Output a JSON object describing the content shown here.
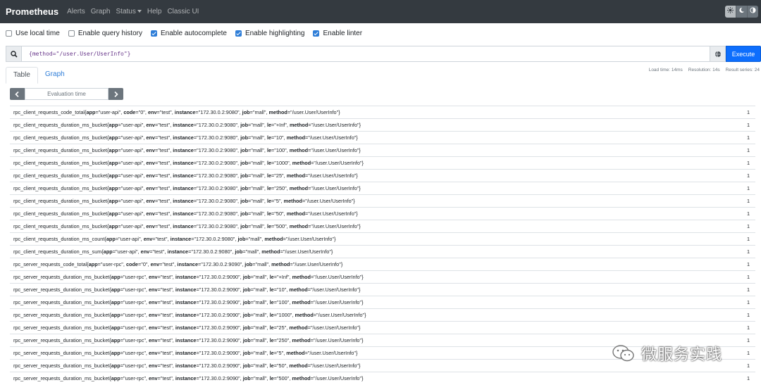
{
  "navbar": {
    "brand": "Prometheus",
    "links": [
      "Alerts",
      "Graph",
      "Status",
      "Help",
      "Classic UI"
    ]
  },
  "options": [
    {
      "label": "Use local time",
      "checked": false
    },
    {
      "label": "Enable query history",
      "checked": false
    },
    {
      "label": "Enable autocomplete",
      "checked": true
    },
    {
      "label": "Enable highlighting",
      "checked": true
    },
    {
      "label": "Enable linter",
      "checked": true
    }
  ],
  "query": {
    "value": "{method=\"/user.User/UserInfo\"}",
    "execute_label": "Execute"
  },
  "tabs": {
    "table": "Table",
    "graph": "Graph"
  },
  "stats": {
    "load_time": "Load time: 14ms",
    "resolution": "Resolution: 14s",
    "result_series": "Result series: 24"
  },
  "eval_time": {
    "placeholder": "Evaluation time"
  },
  "results": [
    {
      "metric": "rpc_client_requests_code_total",
      "labels": [
        [
          "app",
          "user-api"
        ],
        [
          "code",
          "0"
        ],
        [
          "env",
          "test"
        ],
        [
          "instance",
          "172.30.0.2:9080"
        ],
        [
          "job",
          "mall"
        ],
        [
          "method",
          "/user.User/UserInfo"
        ]
      ],
      "value": "1"
    },
    {
      "metric": "rpc_client_requests_duration_ms_bucket",
      "labels": [
        [
          "app",
          "user-api"
        ],
        [
          "env",
          "test"
        ],
        [
          "instance",
          "172.30.0.2:9080"
        ],
        [
          "job",
          "mall"
        ],
        [
          "le",
          "+Inf"
        ],
        [
          "method",
          "/user.User/UserInfo"
        ]
      ],
      "value": "1"
    },
    {
      "metric": "rpc_client_requests_duration_ms_bucket",
      "labels": [
        [
          "app",
          "user-api"
        ],
        [
          "env",
          "test"
        ],
        [
          "instance",
          "172.30.0.2:9080"
        ],
        [
          "job",
          "mall"
        ],
        [
          "le",
          "10"
        ],
        [
          "method",
          "/user.User/UserInfo"
        ]
      ],
      "value": "1"
    },
    {
      "metric": "rpc_client_requests_duration_ms_bucket",
      "labels": [
        [
          "app",
          "user-api"
        ],
        [
          "env",
          "test"
        ],
        [
          "instance",
          "172.30.0.2:9080"
        ],
        [
          "job",
          "mall"
        ],
        [
          "le",
          "100"
        ],
        [
          "method",
          "/user.User/UserInfo"
        ]
      ],
      "value": "1"
    },
    {
      "metric": "rpc_client_requests_duration_ms_bucket",
      "labels": [
        [
          "app",
          "user-api"
        ],
        [
          "env",
          "test"
        ],
        [
          "instance",
          "172.30.0.2:9080"
        ],
        [
          "job",
          "mall"
        ],
        [
          "le",
          "1000"
        ],
        [
          "method",
          "/user.User/UserInfo"
        ]
      ],
      "value": "1"
    },
    {
      "metric": "rpc_client_requests_duration_ms_bucket",
      "labels": [
        [
          "app",
          "user-api"
        ],
        [
          "env",
          "test"
        ],
        [
          "instance",
          "172.30.0.2:9080"
        ],
        [
          "job",
          "mall"
        ],
        [
          "le",
          "25"
        ],
        [
          "method",
          "/user.User/UserInfo"
        ]
      ],
      "value": "1"
    },
    {
      "metric": "rpc_client_requests_duration_ms_bucket",
      "labels": [
        [
          "app",
          "user-api"
        ],
        [
          "env",
          "test"
        ],
        [
          "instance",
          "172.30.0.2:9080"
        ],
        [
          "job",
          "mall"
        ],
        [
          "le",
          "250"
        ],
        [
          "method",
          "/user.User/UserInfo"
        ]
      ],
      "value": "1"
    },
    {
      "metric": "rpc_client_requests_duration_ms_bucket",
      "labels": [
        [
          "app",
          "user-api"
        ],
        [
          "env",
          "test"
        ],
        [
          "instance",
          "172.30.0.2:9080"
        ],
        [
          "job",
          "mall"
        ],
        [
          "le",
          "5"
        ],
        [
          "method",
          "/user.User/UserInfo"
        ]
      ],
      "value": "1"
    },
    {
      "metric": "rpc_client_requests_duration_ms_bucket",
      "labels": [
        [
          "app",
          "user-api"
        ],
        [
          "env",
          "test"
        ],
        [
          "instance",
          "172.30.0.2:9080"
        ],
        [
          "job",
          "mall"
        ],
        [
          "le",
          "50"
        ],
        [
          "method",
          "/user.User/UserInfo"
        ]
      ],
      "value": "1"
    },
    {
      "metric": "rpc_client_requests_duration_ms_bucket",
      "labels": [
        [
          "app",
          "user-api"
        ],
        [
          "env",
          "test"
        ],
        [
          "instance",
          "172.30.0.2:9080"
        ],
        [
          "job",
          "mall"
        ],
        [
          "le",
          "500"
        ],
        [
          "method",
          "/user.User/UserInfo"
        ]
      ],
      "value": "1"
    },
    {
      "metric": "rpc_client_requests_duration_ms_count",
      "labels": [
        [
          "app",
          "user-api"
        ],
        [
          "env",
          "test"
        ],
        [
          "instance",
          "172.30.0.2:9080"
        ],
        [
          "job",
          "mall"
        ],
        [
          "method",
          "/user.User/UserInfo"
        ]
      ],
      "value": "1"
    },
    {
      "metric": "rpc_client_requests_duration_ms_sum",
      "labels": [
        [
          "app",
          "user-api"
        ],
        [
          "env",
          "test"
        ],
        [
          "instance",
          "172.30.0.2:9080"
        ],
        [
          "job",
          "mall"
        ],
        [
          "method",
          "/user.User/UserInfo"
        ]
      ],
      "value": "1"
    },
    {
      "metric": "rpc_server_requests_code_total",
      "labels": [
        [
          "app",
          "user-rpc"
        ],
        [
          "code",
          "0"
        ],
        [
          "env",
          "test"
        ],
        [
          "instance",
          "172.30.0.2:9090"
        ],
        [
          "job",
          "mall"
        ],
        [
          "method",
          "/user.User/UserInfo"
        ]
      ],
      "value": "1"
    },
    {
      "metric": "rpc_server_requests_duration_ms_bucket",
      "labels": [
        [
          "app",
          "user-rpc"
        ],
        [
          "env",
          "test"
        ],
        [
          "instance",
          "172.30.0.2:9090"
        ],
        [
          "job",
          "mall"
        ],
        [
          "le",
          "+Inf"
        ],
        [
          "method",
          "/user.User/UserInfo"
        ]
      ],
      "value": "1"
    },
    {
      "metric": "rpc_server_requests_duration_ms_bucket",
      "labels": [
        [
          "app",
          "user-rpc"
        ],
        [
          "env",
          "test"
        ],
        [
          "instance",
          "172.30.0.2:9090"
        ],
        [
          "job",
          "mall"
        ],
        [
          "le",
          "10"
        ],
        [
          "method",
          "/user.User/UserInfo"
        ]
      ],
      "value": "1"
    },
    {
      "metric": "rpc_server_requests_duration_ms_bucket",
      "labels": [
        [
          "app",
          "user-rpc"
        ],
        [
          "env",
          "test"
        ],
        [
          "instance",
          "172.30.0.2:9090"
        ],
        [
          "job",
          "mall"
        ],
        [
          "le",
          "100"
        ],
        [
          "method",
          "/user.User/UserInfo"
        ]
      ],
      "value": "1"
    },
    {
      "metric": "rpc_server_requests_duration_ms_bucket",
      "labels": [
        [
          "app",
          "user-rpc"
        ],
        [
          "env",
          "test"
        ],
        [
          "instance",
          "172.30.0.2:9090"
        ],
        [
          "job",
          "mall"
        ],
        [
          "le",
          "1000"
        ],
        [
          "method",
          "/user.User/UserInfo"
        ]
      ],
      "value": "1"
    },
    {
      "metric": "rpc_server_requests_duration_ms_bucket",
      "labels": [
        [
          "app",
          "user-rpc"
        ],
        [
          "env",
          "test"
        ],
        [
          "instance",
          "172.30.0.2:9090"
        ],
        [
          "job",
          "mall"
        ],
        [
          "le",
          "25"
        ],
        [
          "method",
          "/user.User/UserInfo"
        ]
      ],
      "value": "1"
    },
    {
      "metric": "rpc_server_requests_duration_ms_bucket",
      "labels": [
        [
          "app",
          "user-rpc"
        ],
        [
          "env",
          "test"
        ],
        [
          "instance",
          "172.30.0.2:9090"
        ],
        [
          "job",
          "mall"
        ],
        [
          "le",
          "250"
        ],
        [
          "method",
          "/user.User/UserInfo"
        ]
      ],
      "value": "1"
    },
    {
      "metric": "rpc_server_requests_duration_ms_bucket",
      "labels": [
        [
          "app",
          "user-rpc"
        ],
        [
          "env",
          "test"
        ],
        [
          "instance",
          "172.30.0.2:9090"
        ],
        [
          "job",
          "mall"
        ],
        [
          "le",
          "5"
        ],
        [
          "method",
          "/user.User/UserInfo"
        ]
      ],
      "value": "1"
    },
    {
      "metric": "rpc_server_requests_duration_ms_bucket",
      "labels": [
        [
          "app",
          "user-rpc"
        ],
        [
          "env",
          "test"
        ],
        [
          "instance",
          "172.30.0.2:9090"
        ],
        [
          "job",
          "mall"
        ],
        [
          "le",
          "50"
        ],
        [
          "method",
          "/user.User/UserInfo"
        ]
      ],
      "value": "1"
    },
    {
      "metric": "rpc_server_requests_duration_ms_bucket",
      "labels": [
        [
          "app",
          "user-rpc"
        ],
        [
          "env",
          "test"
        ],
        [
          "instance",
          "172.30.0.2:9090"
        ],
        [
          "job",
          "mall"
        ],
        [
          "le",
          "500"
        ],
        [
          "method",
          "/user.User/UserInfo"
        ]
      ],
      "value": "1"
    }
  ],
  "watermark": {
    "text": "微服务实践"
  },
  "colors": {
    "navbar": "#343a40",
    "accent": "#0d6efd",
    "checkbox": "#2f7ed8"
  }
}
